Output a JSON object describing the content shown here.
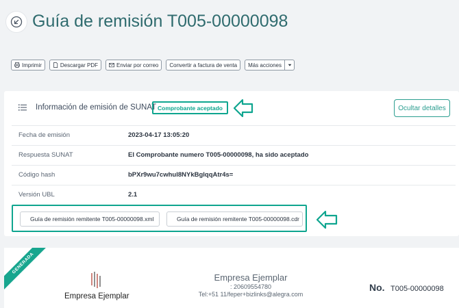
{
  "header": {
    "title": "Guía de remisión T005-00000098",
    "back_icon": "arrow-back-circle-icon"
  },
  "toolbar": {
    "print_label": "Imprimir",
    "download_pdf_label": "Descargar PDF",
    "send_email_label": "Enviar por correo",
    "convert_label": "Convertir a factura de venta",
    "more_actions_label": "Más acciones"
  },
  "sunat": {
    "title": "Información de emisión de SUNAT",
    "status_badge": "Comprobante aceptado",
    "hide_details_label": "Ocultar detalles",
    "rows": [
      {
        "label": "Fecha de emisión",
        "value": "2023-04-17 13:05:20"
      },
      {
        "label": "Respuesta SUNAT",
        "value": "El Comprobante numero T005-00000098, ha sido aceptado"
      },
      {
        "label": "Código hash",
        "value": "bPXr9wu7cwhul8NYkBglqqAtr4s="
      },
      {
        "label": "Versión UBL",
        "value": "2.1"
      }
    ],
    "files": [
      {
        "label": "Guía de remisión remitente T005-00000098.xml"
      },
      {
        "label": "Guía de remisión remitente T005-00000098.cdr"
      }
    ]
  },
  "document": {
    "ribbon": "GENERADA",
    "logo_text": "Empresa Ejemplar",
    "company_name": "Empresa Ejemplar",
    "ruc": ": 20609554780",
    "contact": "Tel:+51 11/feper+bizlinks@alegra.com",
    "number_prefix": "No.",
    "number": "T005-00000098"
  },
  "colors": {
    "accent": "#0ea58f",
    "title": "#2f6b6e",
    "background": "#f1f3f5"
  }
}
